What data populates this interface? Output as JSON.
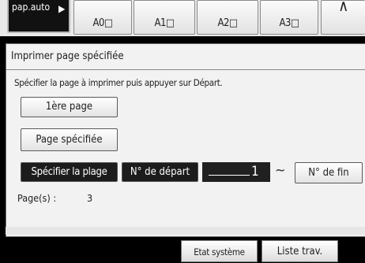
{
  "paper_tabs": {
    "auto": "pap.auto",
    "auto_arrow": "▶",
    "sizes": [
      "A0□",
      "A1□",
      "A2□",
      "A3□",
      "∧"
    ]
  },
  "dialog": {
    "title": "Imprimer page spécifiée",
    "instruction": "Spécifier la page à imprimer puis appuyer sur Départ.",
    "first_page_button": "1ère page",
    "specified_page_button": "Page spécifiée",
    "range_button": "Spécifier la plage",
    "start_button": "N° de départ",
    "start_value": "1",
    "range_separator": "~",
    "end_button": "N° de fin",
    "pages_label": "Page(s) :",
    "pages_count": "3"
  },
  "bottom_bar": {
    "system_status": "Etat système",
    "job_list": "Liste trav."
  }
}
